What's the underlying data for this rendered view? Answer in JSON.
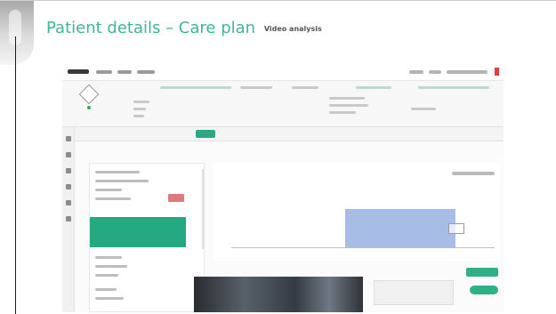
{
  "slide": {
    "title": "Patient details – Care plan",
    "subtitle": "Video analysis"
  },
  "screenshot_icons": [
    "app-logo",
    "diamond-avatar-icon",
    "online-status-dot",
    "nav-icon",
    "cursor-icon"
  ],
  "colors": {
    "title_green": "#3fb59a",
    "accent_green": "#2aa884",
    "chart_bar": "#a8bde6",
    "alert_red": "#e0403f"
  }
}
